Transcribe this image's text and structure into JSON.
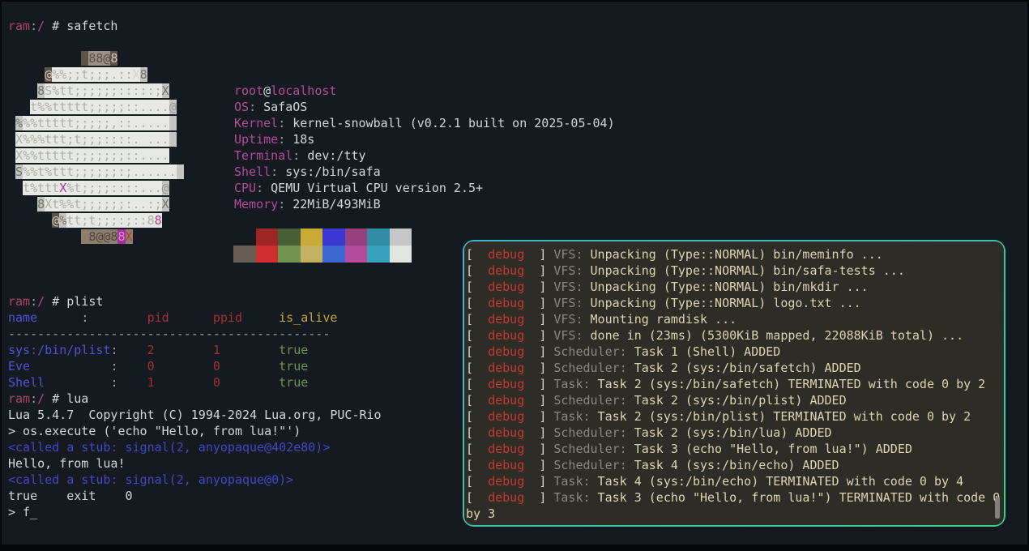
{
  "colors": {
    "fg": "#d2d7db",
    "dim": "#9aa1a8",
    "red": "#a43131",
    "pdrive": "#ab4565",
    "ppath": "#ad4a8e",
    "pink": "#b44b9b",
    "blue": "#5054d4",
    "stub": "#4446c6",
    "yellow": "#c2a633",
    "green": "#6f9450",
    "cream": "#dcd5b2",
    "pgray": "#8c897c",
    "pred": "#c63a31",
    "pbracket": "#d9d9d2",
    "lw": "#e8e8e4",
    "lwFg": "#aeaea8",
    "lwLight": "#d4d4d0",
    "lg": "#c4c4c0",
    "lgFg": "#73736d",
    "lgSoft": "#9a9a94",
    "lb": "#5e5246",
    "lbFg": "#cfc9c0",
    "lt": "#8d7e6d",
    "ltFg": "#4f483f",
    "lt2": "#9c9184",
    "lt2Fg": "#55504b",
    "lm": "#a62da0",
    "lmFg": "#e089d0",
    "lmText": "#b03a90",
    "lRed": "#b23c34"
  },
  "palette": {
    "normal": [
      "#9e2526",
      "#465f35",
      "#c9aa36",
      "#3b38d1",
      "#97407f",
      "#318ca6",
      "#c4c6c7"
    ],
    "bright": [
      "#665e54",
      "#d02f2f",
      "#70944f",
      "#c3b161",
      "#3c66d0",
      "#b44b9b",
      "#39a2be",
      "#e0e5e0"
    ]
  },
  "lines": {
    "prompt_safetch": [
      [
        {
          "t": "ram",
          "c": "pdrive"
        },
        {
          "t": ":",
          "c": "dim"
        },
        {
          "t": "/",
          "c": "ppath"
        },
        {
          "t": " # safetch",
          "c": "fg"
        }
      ]
    ],
    "logo": [
      [
        {
          "t": "          "
        },
        {
          "t": " ",
          "b": "lb"
        },
        {
          "t": "88@",
          "c": "lt2Fg",
          "b": "lt2"
        },
        {
          "t": "8",
          "c": "lbFg",
          "b": "lb"
        }
      ],
      [
        {
          "t": "     "
        },
        {
          "t": "@",
          "c": "lbFg",
          "b": "lb"
        },
        {
          "t": "%%;;t;;;.::",
          "c": "lwFg",
          "b": "lw"
        },
        {
          "t": "X",
          "c": "lwLight",
          "b": "lw"
        },
        {
          "t": "8",
          "c": "lgFg",
          "b": "lg"
        }
      ],
      [
        {
          "t": "    "
        },
        {
          "t": "8",
          "c": "lgFg",
          "b": "lg"
        },
        {
          "t": "S%tt;;;;;;:::::;",
          "c": "lwFg",
          "b": "lw"
        },
        {
          "t": "X",
          "c": "lgFg",
          "b": "lg"
        }
      ],
      [
        {
          "t": "   "
        },
        {
          "t": "t%%ttttt;;;;;::....",
          "c": "lwFg",
          "b": "lw"
        },
        {
          "t": "@",
          "c": "lgSoft",
          "b": "lg"
        }
      ],
      [
        {
          "t": " "
        },
        {
          "t": "%",
          "c": "lgFg",
          "b": "lg"
        },
        {
          "t": "%%ttttt;;;;;,::.....",
          "c": "lwFg",
          "b": "lw"
        },
        {
          "t": " ",
          "b": "lg"
        }
      ],
      [
        {
          "t": " "
        },
        {
          "t": "X%%%ttt;t;;;::::. ...",
          "c": "lwFg",
          "b": "lw"
        },
        {
          "t": " ",
          "b": "lg"
        }
      ],
      [
        {
          "t": " "
        },
        {
          "t": "X%%ttttt;;;;;;;::....",
          "c": "lwFg",
          "b": "lw"
        }
      ],
      [
        {
          "t": " "
        },
        {
          "t": "S",
          "c": "lgFg",
          "b": "lg"
        },
        {
          "t": "%%t%ttt;;;;;;:;......",
          "c": "lwFg",
          "b": "lw"
        },
        {
          "t": " ",
          "b": "lg"
        }
      ],
      [
        {
          "t": "  "
        },
        {
          "t": "t%ttt",
          "c": "lwFg",
          "b": "lw"
        },
        {
          "t": "X",
          "c": "lmText",
          "b": "lw"
        },
        {
          "t": "%t;;;;::::...",
          "c": "lwFg",
          "b": "lw"
        },
        {
          "t": "@",
          "c": "lgSoft",
          "b": "lg"
        }
      ],
      [
        {
          "t": "    "
        },
        {
          "t": "8",
          "c": "lgFg",
          "b": "lg"
        },
        {
          "t": "Xt%%t;;;;;;:..:;",
          "c": "lwFg",
          "b": "lw"
        },
        {
          "t": "X",
          "c": "lgFg",
          "b": "lg"
        }
      ],
      [
        {
          "t": "      "
        },
        {
          "t": "@",
          "c": "lbFg",
          "b": "lb"
        },
        {
          "t": "%",
          "c": "lgFg",
          "b": "lg"
        },
        {
          "t": "tt;t;;;:;::8",
          "c": "lwFg",
          "b": "lw"
        },
        {
          "t": "8",
          "c": "lmText",
          "b": "lw"
        }
      ],
      [
        {
          "t": "          "
        },
        {
          "t": " ",
          "b": "lt"
        },
        {
          "t": "8@@8",
          "c": "ltFg",
          "b": "lt"
        },
        {
          "t": "8",
          "c": "lmFg",
          "b": "lm"
        },
        {
          "t": "X",
          "c": "lRed",
          "b": "lt"
        }
      ]
    ],
    "sysinfo": [
      [
        {
          "t": "root",
          "c": "pink"
        },
        {
          "t": "@",
          "c": "fg"
        },
        {
          "t": "localhost",
          "c": "pink"
        }
      ],
      [
        {
          "t": "OS",
          "c": "pink"
        },
        {
          "t": ": ",
          "c": "dim"
        },
        {
          "t": "SafaOS",
          "c": "fg"
        }
      ],
      [
        {
          "t": "Kernel",
          "c": "pink"
        },
        {
          "t": ": ",
          "c": "dim"
        },
        {
          "t": "kernel-snowball (v0.2.1 built on 2025-05-04)",
          "c": "fg"
        }
      ],
      [
        {
          "t": "Uptime",
          "c": "pink"
        },
        {
          "t": ": ",
          "c": "dim"
        },
        {
          "t": "18s",
          "c": "fg"
        }
      ],
      [
        {
          "t": "Terminal",
          "c": "pink"
        },
        {
          "t": ": ",
          "c": "dim"
        },
        {
          "t": "dev:/tty",
          "c": "fg"
        }
      ],
      [
        {
          "t": "Shell",
          "c": "pink"
        },
        {
          "t": ": ",
          "c": "dim"
        },
        {
          "t": "sys:/bin/safa",
          "c": "fg"
        }
      ],
      [
        {
          "t": "CPU",
          "c": "pink"
        },
        {
          "t": ": ",
          "c": "dim"
        },
        {
          "t": "QEMU Virtual CPU version 2.5+",
          "c": "fg"
        }
      ],
      [
        {
          "t": "Memory",
          "c": "pink"
        },
        {
          "t": ": ",
          "c": "dim"
        },
        {
          "t": "22MiB/493MiB",
          "c": "fg"
        }
      ]
    ],
    "plist_lua": [
      [
        {
          "t": "ram",
          "c": "pdrive"
        },
        {
          "t": ":",
          "c": "dim"
        },
        {
          "t": "/",
          "c": "ppath"
        },
        {
          "t": " # plist",
          "c": "fg"
        }
      ],
      [
        {
          "t": "name",
          "c": "blue"
        },
        {
          "t": "      "
        },
        {
          "t": ":",
          "c": "dim"
        },
        {
          "t": "        "
        },
        {
          "t": "pid",
          "c": "red"
        },
        {
          "t": "      "
        },
        {
          "t": "ppid",
          "c": "red"
        },
        {
          "t": "     "
        },
        {
          "t": "is_alive",
          "c": "yellow"
        }
      ],
      [
        {
          "t": "--------------------------------------------",
          "c": "dim"
        }
      ],
      [
        {
          "t": "sys:/bin/plist",
          "c": "blue"
        },
        {
          "t": ":",
          "c": "dim"
        },
        {
          "t": "    "
        },
        {
          "t": "2",
          "c": "red"
        },
        {
          "t": "        "
        },
        {
          "t": "1",
          "c": "red"
        },
        {
          "t": "        "
        },
        {
          "t": "true",
          "c": "green"
        }
      ],
      [
        {
          "t": "Eve",
          "c": "blue"
        },
        {
          "t": "           "
        },
        {
          "t": ":",
          "c": "dim"
        },
        {
          "t": "    "
        },
        {
          "t": "0",
          "c": "red"
        },
        {
          "t": "        "
        },
        {
          "t": "0",
          "c": "red"
        },
        {
          "t": "        "
        },
        {
          "t": "true",
          "c": "green"
        }
      ],
      [
        {
          "t": "Shell",
          "c": "blue"
        },
        {
          "t": "         "
        },
        {
          "t": ":",
          "c": "dim"
        },
        {
          "t": "    "
        },
        {
          "t": "1",
          "c": "red"
        },
        {
          "t": "        "
        },
        {
          "t": "0",
          "c": "red"
        },
        {
          "t": "        "
        },
        {
          "t": "true",
          "c": "green"
        }
      ],
      [
        {
          "t": "ram",
          "c": "pdrive"
        },
        {
          "t": ":",
          "c": "dim"
        },
        {
          "t": "/",
          "c": "ppath"
        },
        {
          "t": " # lua",
          "c": "fg"
        }
      ],
      [
        {
          "t": "Lua 5.4.7  Copyright (C) 1994-2024 Lua.org, PUC-Rio",
          "c": "fg"
        }
      ],
      [
        {
          "t": "> os.execute ('echo \"Hello, from lua!\"')",
          "c": "fg"
        }
      ],
      [
        {
          "t": "<called a stub: signal(2, anyopaque@402e80)>",
          "c": "stub"
        }
      ],
      [
        {
          "t": "Hello, from lua!",
          "c": "fg"
        }
      ],
      [
        {
          "t": "<called a stub: signal(2, anyopaque@0)>",
          "c": "stub"
        }
      ],
      [
        {
          "t": "true    exit    0",
          "c": "fg"
        }
      ],
      [
        {
          "t": "> f",
          "c": "fg"
        },
        {
          "t": "_",
          "c": "fg"
        }
      ]
    ],
    "panel": [
      [
        {
          "t": "[",
          "c": "pbracket"
        },
        {
          "t": "  "
        },
        {
          "t": "debug",
          "c": "pred"
        },
        {
          "t": "  "
        },
        {
          "t": "]",
          "c": "pbracket"
        },
        {
          "t": " "
        },
        {
          "t": "VFS:",
          "c": "pgray"
        },
        {
          "t": " Unpacking (Type::NORMAL) bin/meminfo ...",
          "c": "cream"
        }
      ],
      [
        {
          "t": "[",
          "c": "pbracket"
        },
        {
          "t": "  "
        },
        {
          "t": "debug",
          "c": "pred"
        },
        {
          "t": "  "
        },
        {
          "t": "]",
          "c": "pbracket"
        },
        {
          "t": " "
        },
        {
          "t": "VFS:",
          "c": "pgray"
        },
        {
          "t": " Unpacking (Type::NORMAL) bin/safa-tests ...",
          "c": "cream"
        }
      ],
      [
        {
          "t": "[",
          "c": "pbracket"
        },
        {
          "t": "  "
        },
        {
          "t": "debug",
          "c": "pred"
        },
        {
          "t": "  "
        },
        {
          "t": "]",
          "c": "pbracket"
        },
        {
          "t": " "
        },
        {
          "t": "VFS:",
          "c": "pgray"
        },
        {
          "t": " Unpacking (Type::NORMAL) bin/mkdir ...",
          "c": "cream"
        }
      ],
      [
        {
          "t": "[",
          "c": "pbracket"
        },
        {
          "t": "  "
        },
        {
          "t": "debug",
          "c": "pred"
        },
        {
          "t": "  "
        },
        {
          "t": "]",
          "c": "pbracket"
        },
        {
          "t": " "
        },
        {
          "t": "VFS:",
          "c": "pgray"
        },
        {
          "t": " Unpacking (Type::NORMAL) logo.txt ...",
          "c": "cream"
        }
      ],
      [
        {
          "t": "[",
          "c": "pbracket"
        },
        {
          "t": "  "
        },
        {
          "t": "debug",
          "c": "pred"
        },
        {
          "t": "  "
        },
        {
          "t": "]",
          "c": "pbracket"
        },
        {
          "t": " "
        },
        {
          "t": "VFS:",
          "c": "pgray"
        },
        {
          "t": " Mounting ramdisk ...",
          "c": "cream"
        }
      ],
      [
        {
          "t": "[",
          "c": "pbracket"
        },
        {
          "t": "  "
        },
        {
          "t": "debug",
          "c": "pred"
        },
        {
          "t": "  "
        },
        {
          "t": "]",
          "c": "pbracket"
        },
        {
          "t": " "
        },
        {
          "t": "VFS:",
          "c": "pgray"
        },
        {
          "t": " done in (23ms) (5300KiB mapped, 22088KiB total) ...",
          "c": "cream"
        }
      ],
      [
        {
          "t": "[",
          "c": "pbracket"
        },
        {
          "t": "  "
        },
        {
          "t": "debug",
          "c": "pred"
        },
        {
          "t": "  "
        },
        {
          "t": "]",
          "c": "pbracket"
        },
        {
          "t": " "
        },
        {
          "t": "Scheduler:",
          "c": "pgray"
        },
        {
          "t": " Task 1 (Shell) ADDED",
          "c": "cream"
        }
      ],
      [
        {
          "t": "[",
          "c": "pbracket"
        },
        {
          "t": "  "
        },
        {
          "t": "debug",
          "c": "pred"
        },
        {
          "t": "  "
        },
        {
          "t": "]",
          "c": "pbracket"
        },
        {
          "t": " "
        },
        {
          "t": "Scheduler:",
          "c": "pgray"
        },
        {
          "t": " Task 2 (sys:/bin/safetch) ADDED",
          "c": "cream"
        }
      ],
      [
        {
          "t": "[",
          "c": "pbracket"
        },
        {
          "t": "  "
        },
        {
          "t": "debug",
          "c": "pred"
        },
        {
          "t": "  "
        },
        {
          "t": "]",
          "c": "pbracket"
        },
        {
          "t": " "
        },
        {
          "t": "Task:",
          "c": "pgray"
        },
        {
          "t": " Task 2 (sys:/bin/safetch) TERMINATED with code 0 by 2",
          "c": "cream"
        }
      ],
      [
        {
          "t": "[",
          "c": "pbracket"
        },
        {
          "t": "  "
        },
        {
          "t": "debug",
          "c": "pred"
        },
        {
          "t": "  "
        },
        {
          "t": "]",
          "c": "pbracket"
        },
        {
          "t": " "
        },
        {
          "t": "Scheduler:",
          "c": "pgray"
        },
        {
          "t": " Task 2 (sys:/bin/plist) ADDED",
          "c": "cream"
        }
      ],
      [
        {
          "t": "[",
          "c": "pbracket"
        },
        {
          "t": "  "
        },
        {
          "t": "debug",
          "c": "pred"
        },
        {
          "t": "  "
        },
        {
          "t": "]",
          "c": "pbracket"
        },
        {
          "t": " "
        },
        {
          "t": "Task:",
          "c": "pgray"
        },
        {
          "t": " Task 2 (sys:/bin/plist) TERMINATED with code 0 by 2",
          "c": "cream"
        }
      ],
      [
        {
          "t": "[",
          "c": "pbracket"
        },
        {
          "t": "  "
        },
        {
          "t": "debug",
          "c": "pred"
        },
        {
          "t": "  "
        },
        {
          "t": "]",
          "c": "pbracket"
        },
        {
          "t": " "
        },
        {
          "t": "Scheduler:",
          "c": "pgray"
        },
        {
          "t": " Task 2 (sys:/bin/lua) ADDED",
          "c": "cream"
        }
      ],
      [
        {
          "t": "[",
          "c": "pbracket"
        },
        {
          "t": "  "
        },
        {
          "t": "debug",
          "c": "pred"
        },
        {
          "t": "  "
        },
        {
          "t": "]",
          "c": "pbracket"
        },
        {
          "t": " "
        },
        {
          "t": "Scheduler:",
          "c": "pgray"
        },
        {
          "t": " Task 3 (echo \"Hello, from lua!\") ADDED",
          "c": "cream"
        }
      ],
      [
        {
          "t": "[",
          "c": "pbracket"
        },
        {
          "t": "  "
        },
        {
          "t": "debug",
          "c": "pred"
        },
        {
          "t": "  "
        },
        {
          "t": "]",
          "c": "pbracket"
        },
        {
          "t": " "
        },
        {
          "t": "Scheduler:",
          "c": "pgray"
        },
        {
          "t": " Task 4 (sys:/bin/echo) ADDED",
          "c": "cream"
        }
      ],
      [
        {
          "t": "[",
          "c": "pbracket"
        },
        {
          "t": "  "
        },
        {
          "t": "debug",
          "c": "pred"
        },
        {
          "t": "  "
        },
        {
          "t": "]",
          "c": "pbracket"
        },
        {
          "t": " "
        },
        {
          "t": "Task:",
          "c": "pgray"
        },
        {
          "t": " Task 4 (sys:/bin/echo) TERMINATED with code 0 by 4",
          "c": "cream"
        }
      ],
      [
        {
          "t": "[",
          "c": "pbracket"
        },
        {
          "t": "  "
        },
        {
          "t": "debug",
          "c": "pred"
        },
        {
          "t": "  "
        },
        {
          "t": "]",
          "c": "pbracket"
        },
        {
          "t": " "
        },
        {
          "t": "Task:",
          "c": "pgray"
        },
        {
          "t": " Task 3 (echo \"Hello, from lua!\") TERMINATED with code 0 by 3",
          "c": "cream"
        }
      ]
    ]
  }
}
